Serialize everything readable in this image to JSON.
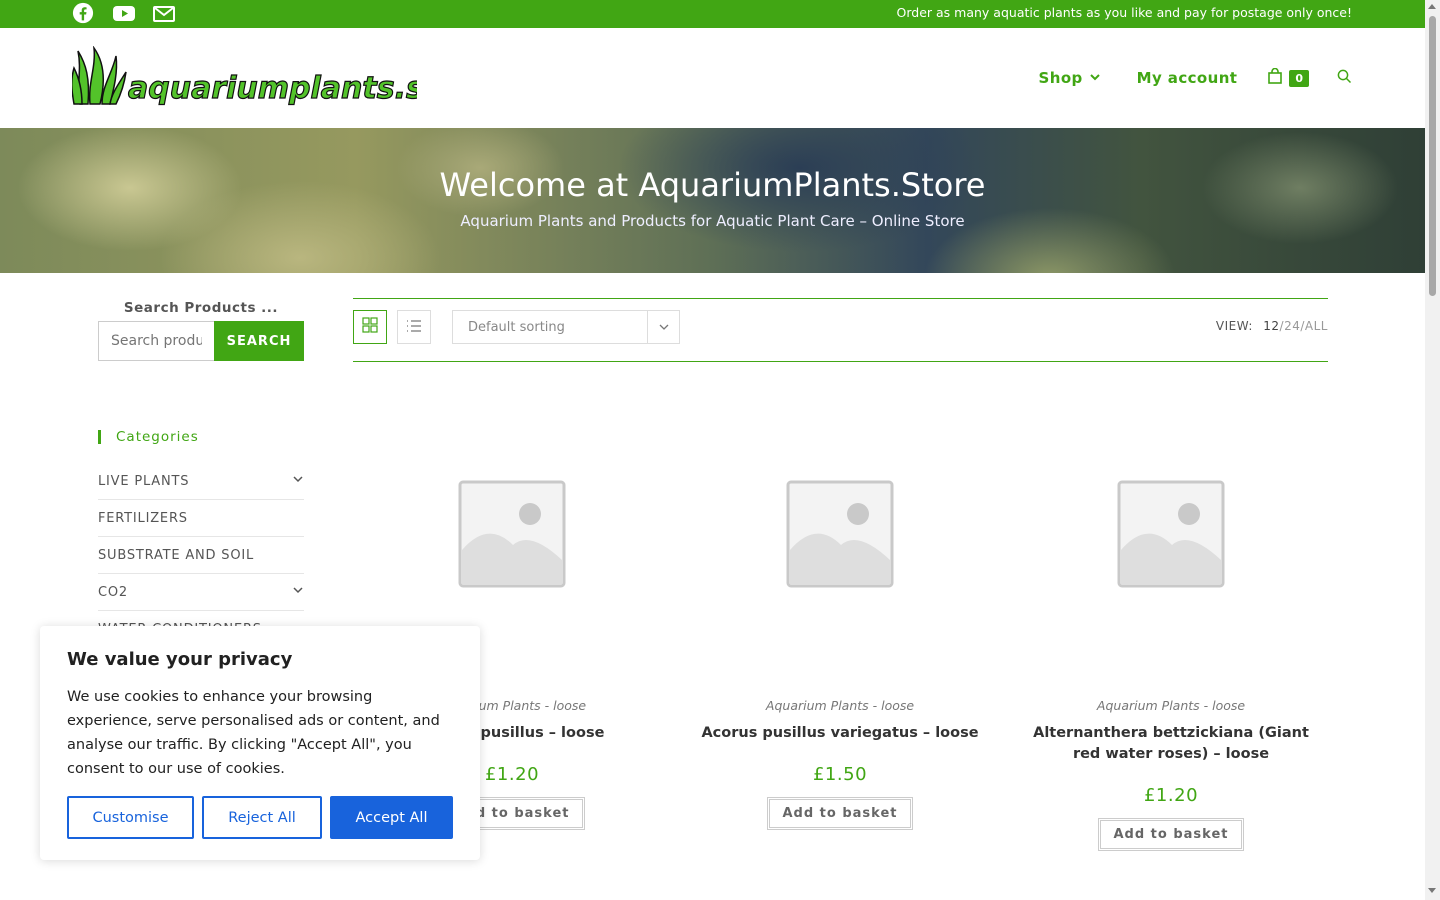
{
  "topbar": {
    "social_icons": [
      "facebook-icon",
      "youtube-icon",
      "envelope-icon"
    ],
    "promo": "Order as many aquatic plants as you like and pay for postage only once!"
  },
  "header": {
    "logo_text": "aquariumplants.store",
    "nav": {
      "shop": "Shop",
      "account": "My account",
      "cart_count": "0"
    }
  },
  "hero": {
    "title": "Welcome at AquariumPlants.Store",
    "subtitle": "Aquarium Plants and Products for Aquatic Plant Care – Online Store"
  },
  "sidebar": {
    "search_title": "Search Products ...",
    "search_placeholder": "Search products…",
    "search_button": "SEARCH",
    "categories_title": "Categories",
    "categories": [
      {
        "label": "LIVE PLANTS",
        "expandable": true
      },
      {
        "label": "FERTILIZERS",
        "expandable": false
      },
      {
        "label": "SUBSTRATE AND SOIL",
        "expandable": false
      },
      {
        "label": "CO2",
        "expandable": true
      },
      {
        "label": "WATER CONDITIONERS",
        "expandable": false
      }
    ]
  },
  "toolbar": {
    "sort_label": "Default sorting",
    "view_label": "VIEW:",
    "view_options": [
      "12",
      "24",
      "ALL"
    ],
    "sep": "/"
  },
  "products": [
    {
      "category": "Aquarium Plants - loose",
      "name": "Acorus pusillus – loose",
      "price": "£1.20",
      "button": "Add to basket"
    },
    {
      "category": "Aquarium Plants - loose",
      "name": "Acorus pusillus variegatus – loose",
      "price": "£1.50",
      "button": "Add to basket"
    },
    {
      "category": "Aquarium Plants - loose",
      "name": "Alternanthera bettzickiana (Giant red water roses) – loose",
      "price": "£1.20",
      "button": "Add to basket"
    }
  ],
  "cookie": {
    "title": "We value your privacy",
    "text": "We use cookies to enhance your browsing experience, serve personalised ads or content, and analyse our traffic. By clicking \"Accept All\", you consent to our use of cookies.",
    "customise": "Customise",
    "reject": "Reject All",
    "accept": "Accept All"
  },
  "colors": {
    "brand_green": "#41a614",
    "cookie_blue": "#1863dc"
  }
}
